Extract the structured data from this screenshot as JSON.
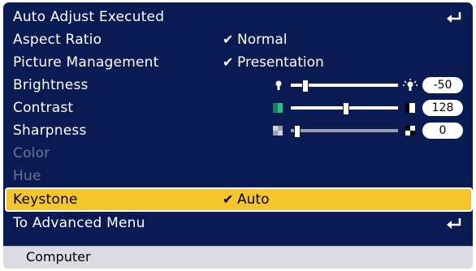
{
  "menu": {
    "items": [
      {
        "label": "Auto Adjust Executed"
      },
      {
        "label": "Aspect Ratio",
        "value": "Normal"
      },
      {
        "label": "Picture Management",
        "value": "Presentation"
      },
      {
        "label": "Brightness",
        "level": "-50"
      },
      {
        "label": "Contrast",
        "level": "128"
      },
      {
        "label": "Sharpness",
        "level": "0"
      },
      {
        "label": "Color"
      },
      {
        "label": "Hue"
      },
      {
        "label": "Keystone",
        "value": "Auto"
      },
      {
        "label": "To Advanced Menu"
      }
    ]
  },
  "footer": {
    "source": "Computer"
  },
  "colors": {
    "background": "#0a1a52",
    "highlight": "#f3c62e",
    "disabled": "#6b7494",
    "footer": "#dcdbe3"
  }
}
